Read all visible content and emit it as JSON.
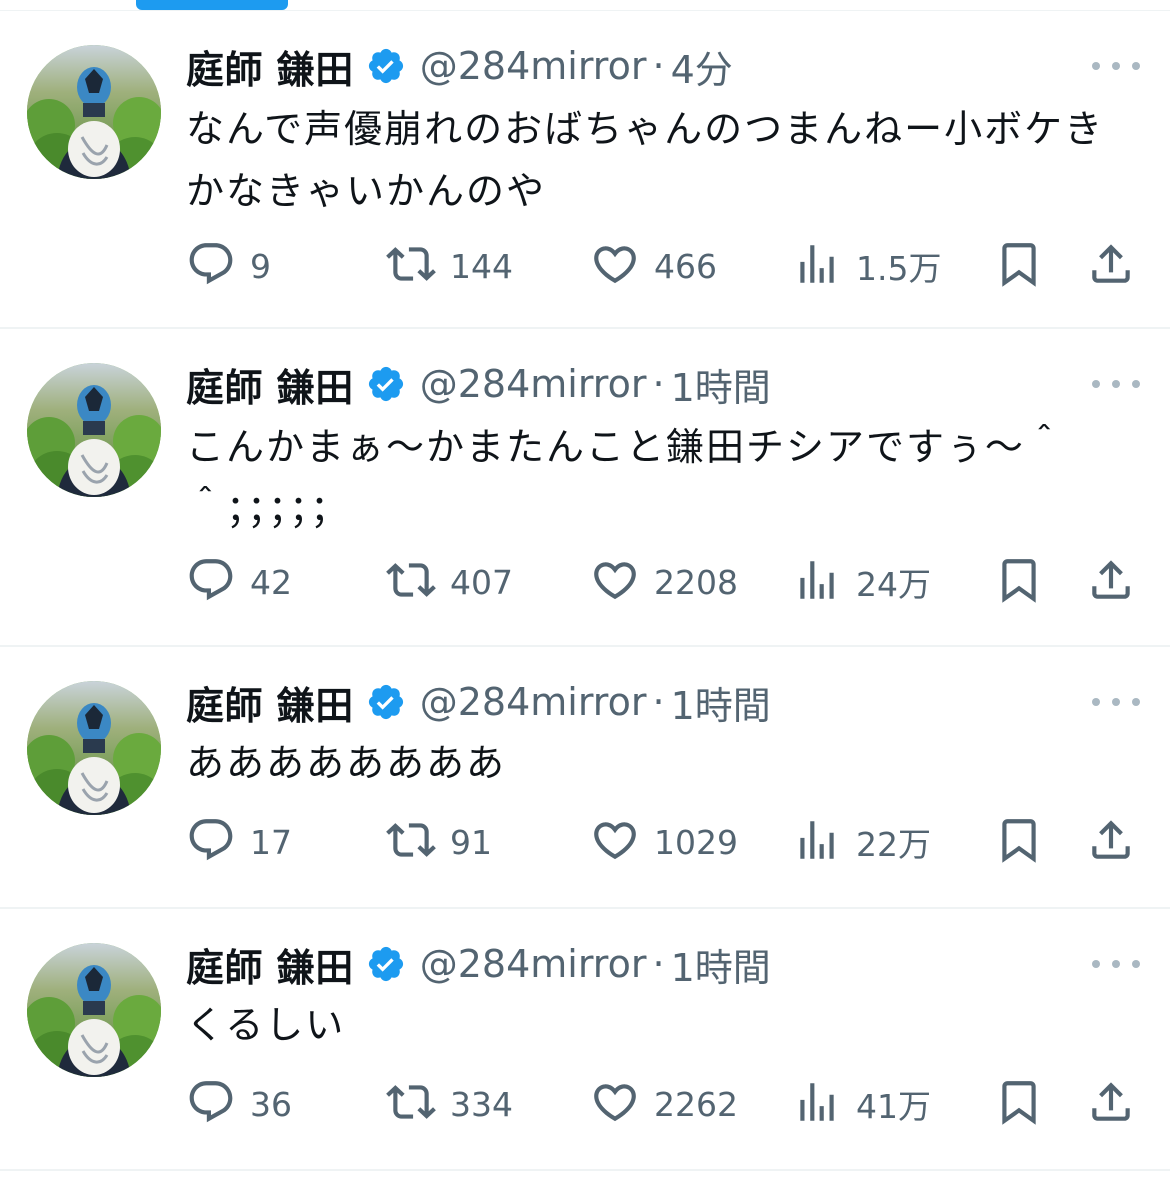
{
  "colors": {
    "accent": "#1d9bf0",
    "secondary_text": "#536471",
    "divider": "#eff3f4"
  },
  "tweets": [
    {
      "display_name": "庭師 鎌田",
      "handle": "@284mirror",
      "separator": "·",
      "time": "4分",
      "text": "なんで声優崩れのおばちゃんのつまんねー小ボケきかなきゃいかんのや",
      "replies": "9",
      "retweets": "144",
      "likes": "466",
      "views": "1.5万"
    },
    {
      "display_name": "庭師 鎌田",
      "handle": "@284mirror",
      "separator": "·",
      "time": "1時間",
      "text": "こんかまぁ〜かまたんこと鎌田チシアですぅ〜＾＾；；；；；",
      "replies": "42",
      "retweets": "407",
      "likes": "2208",
      "views": "24万"
    },
    {
      "display_name": "庭師 鎌田",
      "handle": "@284mirror",
      "separator": "·",
      "time": "1時間",
      "text": "ああああああああ",
      "replies": "17",
      "retweets": "91",
      "likes": "1029",
      "views": "22万"
    },
    {
      "display_name": "庭師 鎌田",
      "handle": "@284mirror",
      "separator": "·",
      "time": "1時間",
      "text": "くるしい",
      "replies": "36",
      "retweets": "334",
      "likes": "2262",
      "views": "41万"
    }
  ],
  "icons": {
    "avatar": "avatar-photo",
    "verified": "verified-badge-icon",
    "more": "more-options-icon",
    "reply": "reply-icon",
    "retweet": "retweet-icon",
    "like": "like-icon",
    "views": "views-icon",
    "bookmark": "bookmark-icon",
    "share": "share-icon"
  }
}
